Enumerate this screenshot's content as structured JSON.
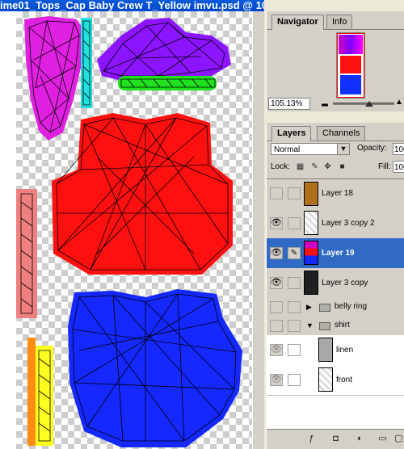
{
  "document": {
    "title": "ime01_Tops_Cap Baby Crew T_Yellow imvu.psd @ 10"
  },
  "navigator": {
    "tabs": [
      "Navigator",
      "Info"
    ],
    "active_tab": "Navigator",
    "zoom": "105.13%"
  },
  "layers_panel": {
    "tabs": [
      "Layers",
      "Channels"
    ],
    "active_tab": "Layers",
    "blend_mode": "Normal",
    "opacity_label": "Opacity:",
    "opacity_value": "100",
    "lock_label": "Lock:",
    "fill_label": "Fill:",
    "fill_value": "100",
    "layers": [
      {
        "name": "Layer 18",
        "visible": false,
        "selected": false,
        "type": "layer"
      },
      {
        "name": "Layer 3 copy 2",
        "visible": true,
        "selected": false,
        "type": "layer"
      },
      {
        "name": "Layer 19",
        "visible": true,
        "selected": true,
        "type": "layer"
      },
      {
        "name": "Layer 3 copy",
        "visible": true,
        "selected": false,
        "type": "layer"
      },
      {
        "name": "belly ring",
        "visible": false,
        "selected": false,
        "type": "group",
        "expanded": false
      },
      {
        "name": "shirt",
        "visible": false,
        "selected": false,
        "type": "group",
        "expanded": true
      },
      {
        "name": "linen",
        "visible": true,
        "selected": false,
        "type": "layer"
      },
      {
        "name": "front",
        "visible": true,
        "selected": false,
        "type": "layer"
      }
    ]
  },
  "colors": {
    "title_bar": "#0047c8",
    "selection": "#316ac5",
    "magenta": "#e020e0",
    "purple": "#8c14ff",
    "red": "#ff1010",
    "blue": "#1428ff",
    "cyan": "#20e0e0",
    "green": "#20e020",
    "salmon": "#f08080",
    "yellow": "#ffff20",
    "orange": "#ff8c10"
  }
}
